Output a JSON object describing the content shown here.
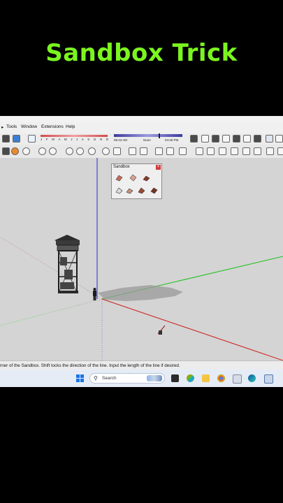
{
  "caption": "Sandbox Trick",
  "menu": {
    "items": [
      "Tools",
      "Window",
      "Extensions",
      "Help"
    ]
  },
  "shadow": {
    "months": "J F M A M J J A S O N D",
    "time_start": "06:43 AM",
    "time_mid": "Noon",
    "time_end": "04:45 PM"
  },
  "sandbox_panel": {
    "title": "Sandbox",
    "close": "×"
  },
  "status": {
    "text": "rner of the Sandbox.  Shift locks the direction of the line.  Input the length of the line if desired."
  },
  "taskbar": {
    "search_placeholder": "Search"
  },
  "colors": {
    "caption": "#7bf51f",
    "axis_blue": "#2a2ad0",
    "axis_red": "#d02020",
    "axis_green": "#18c018"
  }
}
